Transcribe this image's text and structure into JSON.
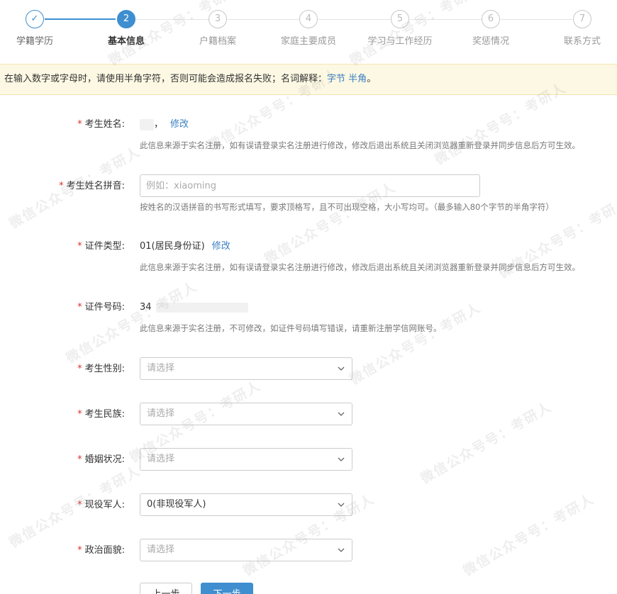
{
  "steps": [
    {
      "num": "✓",
      "label": "学籍学历",
      "state": "done"
    },
    {
      "num": "2",
      "label": "基本信息",
      "state": "active"
    },
    {
      "num": "3",
      "label": "户籍档案",
      "state": "todo"
    },
    {
      "num": "4",
      "label": "家庭主要成员",
      "state": "todo"
    },
    {
      "num": "5",
      "label": "学习与工作经历",
      "state": "todo"
    },
    {
      "num": "6",
      "label": "奖惩情况",
      "state": "todo"
    },
    {
      "num": "7",
      "label": "联系方式",
      "state": "todo"
    }
  ],
  "notice": {
    "text": "在输入数字或字母时，请使用半角字符，否则可能会造成报名失败；名词解释：",
    "link1": "字节",
    "link2": "半角",
    "tail": "。"
  },
  "form": {
    "name": {
      "label": "考生姓名:",
      "value": "，",
      "edit": "修改",
      "help": "此信息来源于实名注册，如有误请登录实名注册进行修改，修改后退出系统且关闭浏览器重新登录并同步信息后方可生效。"
    },
    "pinyin": {
      "label": "考生姓名拼音:",
      "placeholder": "例如：xiaoming",
      "help": "按姓名的汉语拼音的书写形式填写，要求顶格写，且不可出现空格，大小写均可。（最多输入80个字节的半角字符）"
    },
    "id_type": {
      "label": "证件类型:",
      "value": "01(居民身份证)",
      "edit": "修改",
      "help": "此信息来源于实名注册，如有误请登录实名注册进行修改，修改后退出系统且关闭浏览器重新登录并同步信息后方可生效。"
    },
    "id_number": {
      "label": "证件号码:",
      "value": "34",
      "help": "此信息来源于实名注册，不可修改，如证件号码填写错误，请重新注册学信网账号。"
    },
    "gender": {
      "label": "考生性别:",
      "value": "请选择"
    },
    "ethnicity": {
      "label": "考生民族:",
      "value": "请选择"
    },
    "marital": {
      "label": "婚姻状况:",
      "value": "请选择"
    },
    "military": {
      "label": "现役军人:",
      "value": "0(非现役军人)"
    },
    "political": {
      "label": "政治面貌:",
      "value": "请选择"
    }
  },
  "buttons": {
    "prev": "上一步",
    "next": "下一步"
  },
  "watermark": "微信公众号号：考研人",
  "colors": {
    "primary": "#3e8ed0",
    "required": "#d9322e",
    "notice_bg": "#fcf8e3",
    "link": "#3a7fc3"
  }
}
